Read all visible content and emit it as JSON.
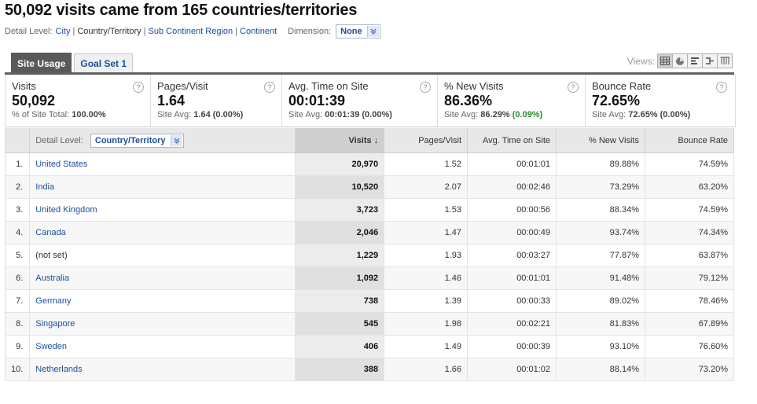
{
  "title": "50,092 visits came from 165 countries/territories",
  "detail": {
    "label": "Detail Level:",
    "options": [
      "City",
      "Country/Territory",
      "Sub Continent Region",
      "Continent"
    ],
    "current": "Country/Territory",
    "dimension_label": "Dimension:",
    "dimension_value": "None"
  },
  "tabs": [
    "Site Usage",
    "Goal Set 1"
  ],
  "views_label": "Views:",
  "scorecards": [
    {
      "name": "Visits",
      "value": "50,092",
      "sub_prefix": "% of Site Total:",
      "sub_value": "100.00%",
      "sub_delta": ""
    },
    {
      "name": "Pages/Visit",
      "value": "1.64",
      "sub_prefix": "Site Avg:",
      "sub_value": "1.64 (0.00%)",
      "sub_delta": ""
    },
    {
      "name": "Avg. Time on Site",
      "value": "00:01:39",
      "sub_prefix": "Site Avg:",
      "sub_value": "00:01:39 (0.00%)",
      "sub_delta": ""
    },
    {
      "name": "% New Visits",
      "value": "86.36%",
      "sub_prefix": "Site Avg:",
      "sub_value": "86.29%",
      "sub_delta": "(0.09%)"
    },
    {
      "name": "Bounce Rate",
      "value": "72.65%",
      "sub_prefix": "Site Avg:",
      "sub_value": "72.65% (0.00%)",
      "sub_delta": ""
    }
  ],
  "help_glyph": "?",
  "table": {
    "detail_label": "Detail Level:",
    "detail_value": "Country/Territory",
    "columns": [
      "Visits",
      "Pages/Visit",
      "Avg. Time on Site",
      "% New Visits",
      "Bounce Rate"
    ],
    "sort_arrow": "↓",
    "rows": [
      {
        "n": "1.",
        "name": "United States",
        "link": true,
        "visits": "20,970",
        "ppv": "1.52",
        "time": "00:01:01",
        "new": "89.88%",
        "bounce": "74.59%"
      },
      {
        "n": "2.",
        "name": "India",
        "link": true,
        "visits": "10,520",
        "ppv": "2.07",
        "time": "00:02:46",
        "new": "73.29%",
        "bounce": "63.20%"
      },
      {
        "n": "3.",
        "name": "United Kingdom",
        "link": true,
        "visits": "3,723",
        "ppv": "1.53",
        "time": "00:00:56",
        "new": "88.34%",
        "bounce": "74.59%"
      },
      {
        "n": "4.",
        "name": "Canada",
        "link": true,
        "visits": "2,046",
        "ppv": "1.47",
        "time": "00:00:49",
        "new": "93.74%",
        "bounce": "74.34%"
      },
      {
        "n": "5.",
        "name": "(not set)",
        "link": false,
        "visits": "1,229",
        "ppv": "1.93",
        "time": "00:03:27",
        "new": "77.87%",
        "bounce": "63.87%"
      },
      {
        "n": "6.",
        "name": "Australia",
        "link": true,
        "visits": "1,092",
        "ppv": "1.46",
        "time": "00:01:01",
        "new": "91.48%",
        "bounce": "79.12%"
      },
      {
        "n": "7.",
        "name": "Germany",
        "link": true,
        "visits": "738",
        "ppv": "1.39",
        "time": "00:00:33",
        "new": "89.02%",
        "bounce": "78.46%"
      },
      {
        "n": "8.",
        "name": "Singapore",
        "link": true,
        "visits": "545",
        "ppv": "1.98",
        "time": "00:02:21",
        "new": "81.83%",
        "bounce": "67.89%"
      },
      {
        "n": "9.",
        "name": "Sweden",
        "link": true,
        "visits": "406",
        "ppv": "1.49",
        "time": "00:00:39",
        "new": "93.10%",
        "bounce": "76.60%"
      },
      {
        "n": "10.",
        "name": "Netherlands",
        "link": true,
        "visits": "388",
        "ppv": "1.66",
        "time": "00:01:02",
        "new": "88.14%",
        "bounce": "73.20%"
      }
    ]
  }
}
